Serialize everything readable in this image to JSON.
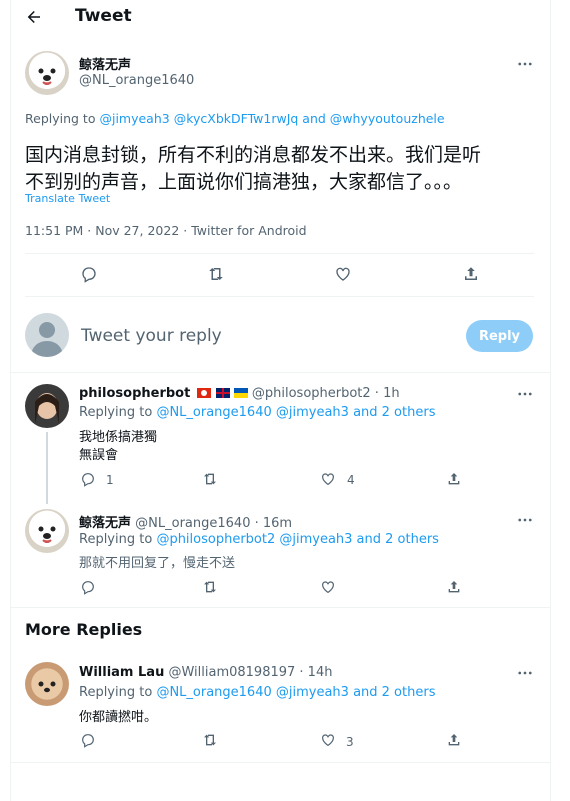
{
  "header": {
    "title": "Tweet"
  },
  "main_tweet": {
    "display_name": "鲸落无声",
    "handle": "@NL_orange1640",
    "replying_label": "Replying to",
    "replying_users": "@jimyeah3 @kycXbkDFTw1rwJq and @whyyoutouzhele",
    "text_line1": "国内消息封锁，所有不利的消息都发不出来。我们是听",
    "text_line2": "不到别的声音，上面说你们搞港独，大家都信了。。。",
    "translate": "Translate Tweet",
    "timestamp": "11:51 PM · Nov 27, 2022 · Twitter for Android"
  },
  "composer": {
    "placeholder": "Tweet your reply",
    "reply_button": "Reply"
  },
  "replies": [
    {
      "display_name": "philosopherbot",
      "handle": "@philosopherbot2 · 1h",
      "replying_label": "Replying to",
      "replying_users": "@NL_orange1640 @jimyeah3 and 2 others",
      "text_line1": "我地係搞港獨",
      "text_line2": "無誤會",
      "reply_count": "1",
      "like_count": "4"
    },
    {
      "display_name": "鲸落无声",
      "handle": "@NL_orange1640 · 16m",
      "replying_label": "Replying to",
      "replying_users": "@philosopherbot2 @jimyeah3 and 2 others",
      "text_line1": "那就不用回复了，慢走不送"
    }
  ],
  "more_replies": {
    "heading": "More Replies",
    "items": [
      {
        "display_name": "William Lau",
        "handle": "@William08198197 · 14h",
        "replying_label": "Replying to",
        "replying_users": "@NL_orange1640 @jimyeah3 and 2 others",
        "text_line1": "你都讀撚咁。",
        "like_count": "3"
      }
    ]
  },
  "colors": {
    "accent": "#1d9bf0",
    "muted": "#536471",
    "reply_button_bg": "#8ecdf8"
  }
}
